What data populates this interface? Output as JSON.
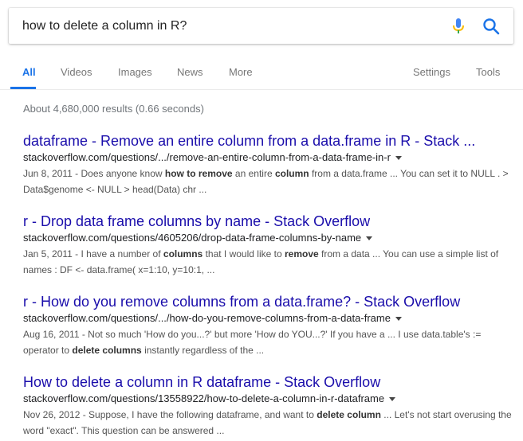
{
  "search": {
    "query": "how to delete a column in R?"
  },
  "tabs": {
    "all": "All",
    "videos": "Videos",
    "images": "Images",
    "news": "News",
    "more": "More",
    "settings": "Settings",
    "tools": "Tools"
  },
  "stats": "About 4,680,000 results (0.66 seconds)",
  "colors": {
    "accent": "#1a73e8",
    "link": "#1a0dab",
    "mic_blue": "#4285f4",
    "mic_yellow": "#fbbc05"
  },
  "icons": {
    "mic": "mic-icon",
    "search": "search-icon"
  },
  "results": [
    {
      "title": "dataframe - Remove an entire column from a data.frame in R - Stack ...",
      "url": "stackoverflow.com/questions/.../remove-an-entire-column-from-a-data-frame-in-r",
      "date": "Jun 8, 2011",
      "snippet": [
        {
          "t": " - Does anyone know "
        },
        {
          "b": "how to remove"
        },
        {
          "t": " an entire "
        },
        {
          "b": "column"
        },
        {
          "t": " from a data.frame ... You can set it to NULL . > Data$genome <- NULL > head(Data) chr ..."
        }
      ]
    },
    {
      "title": "r - Drop data frame columns by name - Stack Overflow",
      "url": "stackoverflow.com/questions/4605206/drop-data-frame-columns-by-name",
      "date": "Jan 5, 2011",
      "snippet": [
        {
          "t": " - I have a number of "
        },
        {
          "b": "columns"
        },
        {
          "t": " that I would like to "
        },
        {
          "b": "remove"
        },
        {
          "t": " from a data ... You can use a simple list of names : DF <- data.frame( x=1:10, y=10:1, ..."
        }
      ]
    },
    {
      "title": "r - How do you remove columns from a data.frame? - Stack Overflow",
      "url": "stackoverflow.com/questions/.../how-do-you-remove-columns-from-a-data-frame",
      "date": "Aug 16, 2011",
      "snippet": [
        {
          "t": " - Not so much 'How do you...?' but more 'How do YOU...?' If you have a ... I use data.table's := operator to "
        },
        {
          "b": "delete columns"
        },
        {
          "t": " instantly regardless of the ..."
        }
      ]
    },
    {
      "title": "How to delete a column in R dataframe - Stack Overflow",
      "url": "stackoverflow.com/questions/13558922/how-to-delete-a-column-in-r-dataframe",
      "date": "Nov 26, 2012",
      "snippet": [
        {
          "t": " - Suppose, I have the following dataframe, and want to "
        },
        {
          "b": "delete column"
        },
        {
          "t": " ... Let's not start overusing the word \"exact\". This question can be answered ..."
        }
      ]
    }
  ]
}
